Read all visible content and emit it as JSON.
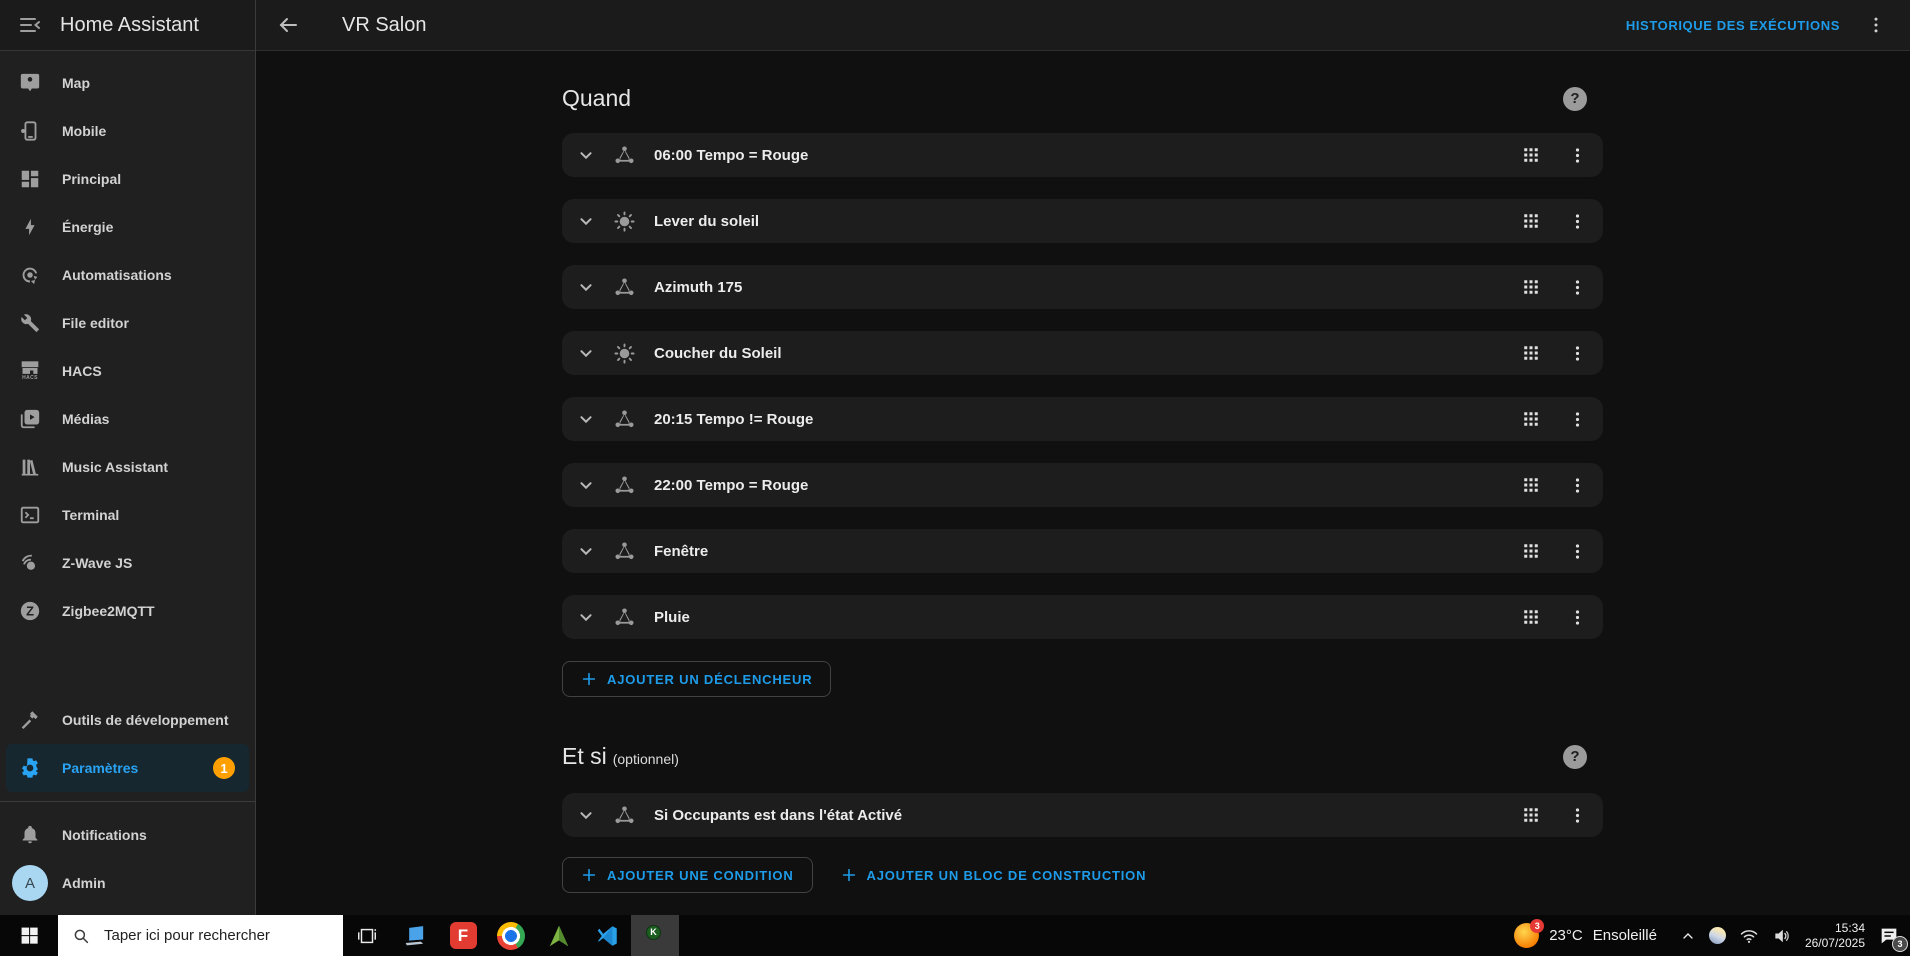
{
  "app": {
    "title": "Home Assistant"
  },
  "header": {
    "title": "VR Salon",
    "action_label": "HISTORIQUE DES EXÉCUTIONS"
  },
  "help_glyph": "?",
  "sidebar": {
    "items": [
      {
        "label": "Map",
        "icon": "tooltip-account-icon"
      },
      {
        "label": "Mobile",
        "icon": "cellphone-cog-icon"
      },
      {
        "label": "Principal",
        "icon": "dashboard-icon"
      },
      {
        "label": "Énergie",
        "icon": "lightning-bolt-icon"
      },
      {
        "label": "Automatisations",
        "icon": "automation-gear-icon"
      },
      {
        "label": "File editor",
        "icon": "wrench-icon"
      },
      {
        "label": "HACS",
        "icon": "hacs-store-icon"
      },
      {
        "label": "Médias",
        "icon": "play-box-icon"
      },
      {
        "label": "Music Assistant",
        "icon": "bookshelf-icon"
      },
      {
        "label": "Terminal",
        "icon": "console-icon"
      },
      {
        "label": "Z-Wave JS",
        "icon": "zwave-icon"
      },
      {
        "label": "Zigbee2MQTT",
        "icon": "zigbee-icon"
      }
    ],
    "dev_item": {
      "label": "Outils de développement",
      "icon": "hammer-icon"
    },
    "settings_item": {
      "label": "Paramètres",
      "icon": "gear-icon",
      "badge": "1",
      "selected": true
    },
    "notifications_item": {
      "label": "Notifications",
      "icon": "bell-icon"
    },
    "user_item": {
      "label": "Admin",
      "avatar_letter": "A"
    }
  },
  "main": {
    "quand": {
      "heading": "Quand",
      "rows": [
        {
          "icon": "graph",
          "label": "06:00 Tempo = Rouge"
        },
        {
          "icon": "sun",
          "label": "Lever du soleil"
        },
        {
          "icon": "graph",
          "label": "Azimuth 175"
        },
        {
          "icon": "sun",
          "label": "Coucher du Soleil"
        },
        {
          "icon": "graph",
          "label": "20:15 Tempo != Rouge"
        },
        {
          "icon": "graph",
          "label": "22:00 Tempo = Rouge"
        },
        {
          "icon": "graph",
          "label": "Fenêtre"
        },
        {
          "icon": "graph",
          "label": "Pluie"
        }
      ],
      "add_button": "AJOUTER UN DÉCLENCHEUR"
    },
    "etsi": {
      "heading": "Et si",
      "subheading": "(optionnel)",
      "rows": [
        {
          "icon": "graph",
          "label": "Si Occupants est dans l'état Activé"
        }
      ],
      "add_condition": "AJOUTER UNE CONDITION",
      "add_block": "AJOUTER UN BLOC DE CONSTRUCTION"
    }
  },
  "icons": {
    "zwave_letter": "Z",
    "zigbee_letter": "Z",
    "red_app_letter": "F",
    "chrome_profile_letter": "K",
    "hacs_label": "HACS"
  },
  "taskbar": {
    "search_placeholder": "Taper ici pour rechercher",
    "apps": [
      "task-view",
      "laptop-app",
      "red-f-app",
      "chrome",
      "green-arrow-app",
      "vscode",
      "chrome-profile-k"
    ],
    "tray": {
      "weather_badge": "3",
      "temperature": "23°C",
      "condition": "Ensoleillé",
      "time": "15:34",
      "date": "26/07/2025",
      "notification_badge": "3"
    }
  },
  "colors": {
    "accent": "#1e9ce9",
    "selected_sidebar_bg": "#16272f",
    "badge_orange": "#ffa000",
    "weather_badge_red": "#e53935",
    "avatar_blue": "#a9d7f2",
    "card_bg": "#1d1d1d",
    "sidebar_bg": "#202020",
    "content_bg": "#101010"
  }
}
